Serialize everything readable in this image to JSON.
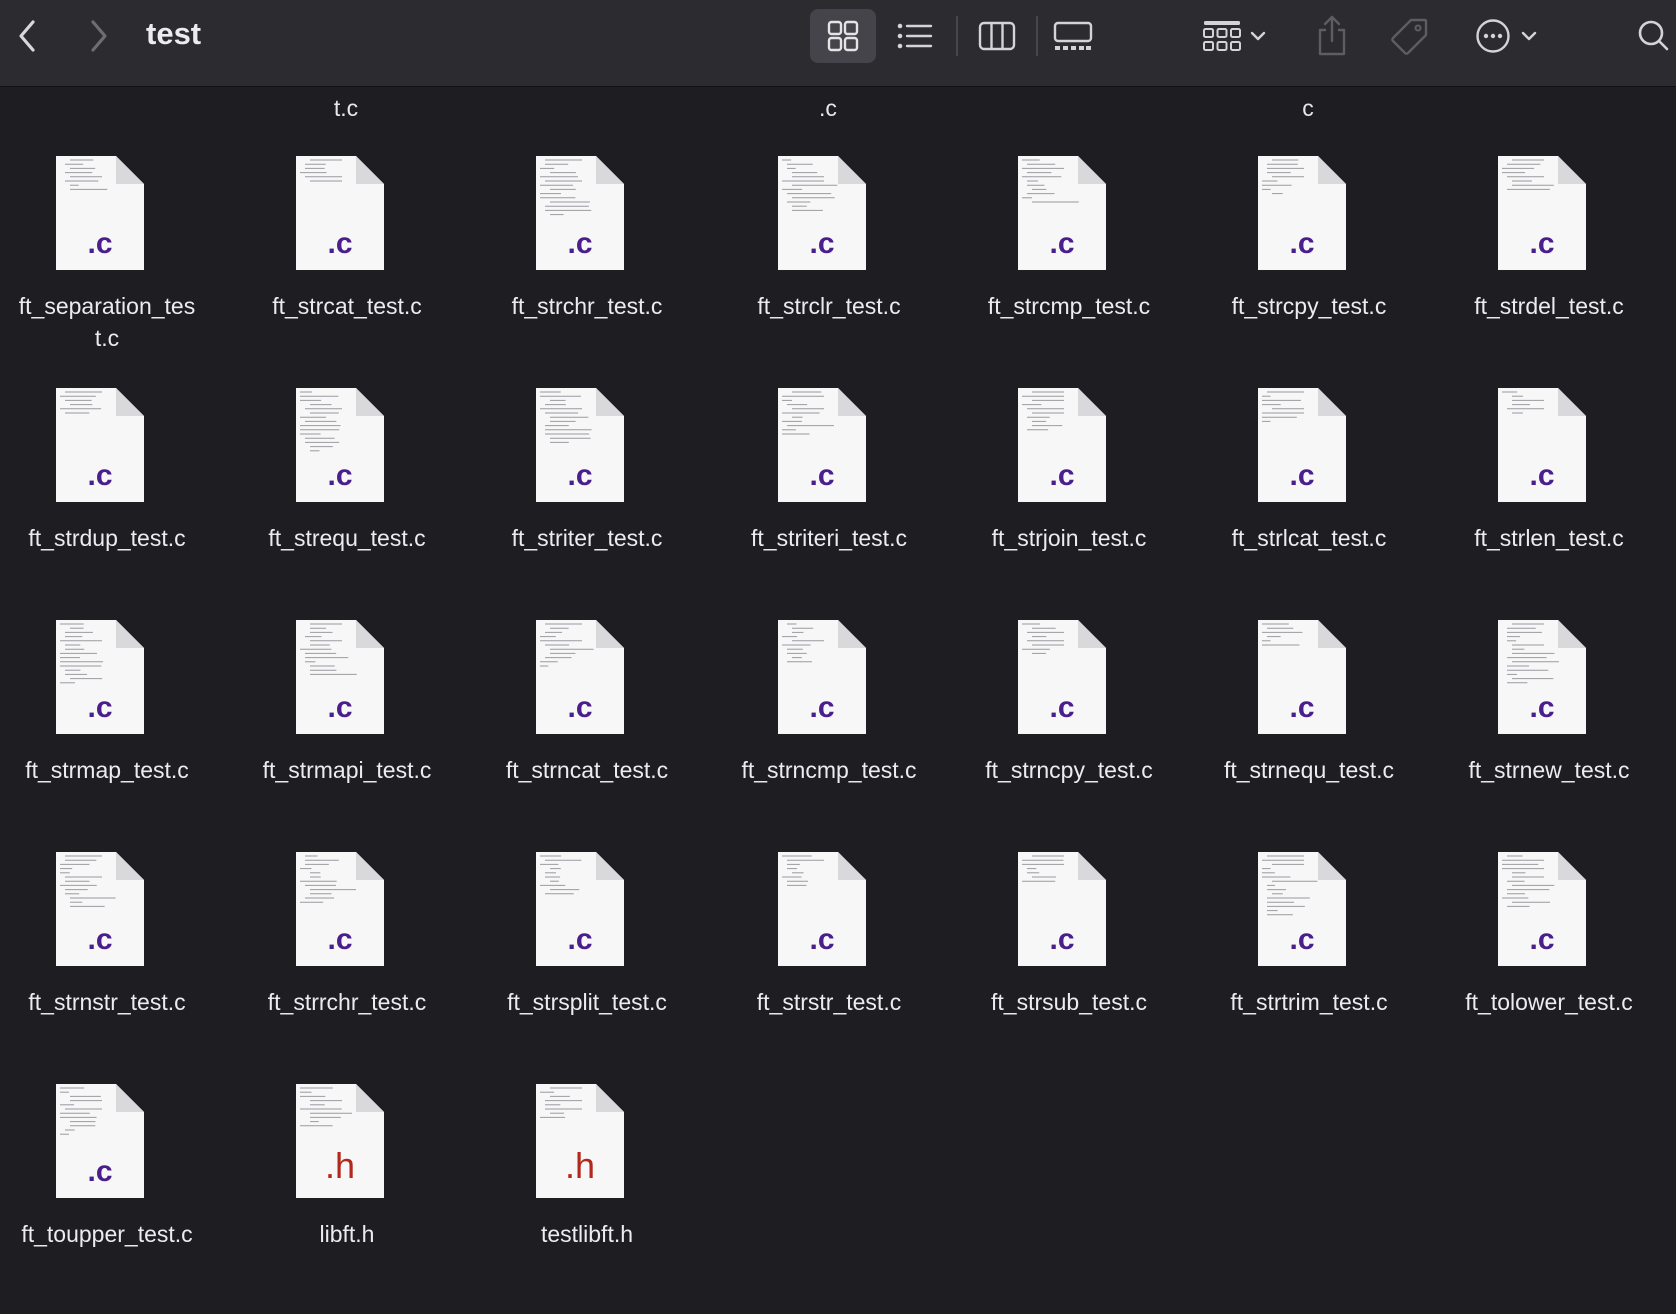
{
  "window": {
    "title": "test"
  },
  "toolbar": {
    "back_icon": "chevron-left-icon",
    "forward_icon": "chevron-right-icon",
    "views": [
      "icon-view-icon",
      "list-view-icon",
      "column-view-icon",
      "gallery-view-icon"
    ],
    "active_view": "icon-view-icon",
    "group_icon": "group-by-icon",
    "share_icon": "share-icon",
    "tag_icon": "tag-icon",
    "more_icon": "ellipsis-circle-icon",
    "search_icon": "search-icon"
  },
  "previous_row_labels": [
    "t.c",
    ".c",
    "c"
  ],
  "files": [
    {
      "name": "ft_separation_tes\nt.c",
      "ext": ".c"
    },
    {
      "name": "ft_strcat_test.c",
      "ext": ".c"
    },
    {
      "name": "ft_strchr_test.c",
      "ext": ".c"
    },
    {
      "name": "ft_strclr_test.c",
      "ext": ".c"
    },
    {
      "name": "ft_strcmp_test.c",
      "ext": ".c"
    },
    {
      "name": "ft_strcpy_test.c",
      "ext": ".c"
    },
    {
      "name": "ft_strdel_test.c",
      "ext": ".c"
    },
    {
      "name": "ft_strdup_test.c",
      "ext": ".c"
    },
    {
      "name": "ft_strequ_test.c",
      "ext": ".c"
    },
    {
      "name": "ft_striter_test.c",
      "ext": ".c"
    },
    {
      "name": "ft_striteri_test.c",
      "ext": ".c"
    },
    {
      "name": "ft_strjoin_test.c",
      "ext": ".c"
    },
    {
      "name": "ft_strlcat_test.c",
      "ext": ".c"
    },
    {
      "name": "ft_strlen_test.c",
      "ext": ".c"
    },
    {
      "name": "ft_strmap_test.c",
      "ext": ".c"
    },
    {
      "name": "ft_strmapi_test.c",
      "ext": ".c"
    },
    {
      "name": "ft_strncat_test.c",
      "ext": ".c"
    },
    {
      "name": "ft_strncmp_test.c",
      "ext": ".c"
    },
    {
      "name": "ft_strncpy_test.c",
      "ext": ".c"
    },
    {
      "name": "ft_strnequ_test.c",
      "ext": ".c"
    },
    {
      "name": "ft_strnew_test.c",
      "ext": ".c"
    },
    {
      "name": "ft_strnstr_test.c",
      "ext": ".c"
    },
    {
      "name": "ft_strrchr_test.c",
      "ext": ".c"
    },
    {
      "name": "ft_strsplit_test.c",
      "ext": ".c"
    },
    {
      "name": "ft_strstr_test.c",
      "ext": ".c"
    },
    {
      "name": "ft_strsub_test.c",
      "ext": ".c"
    },
    {
      "name": "ft_strtrim_test.c",
      "ext": ".c"
    },
    {
      "name": "ft_tolower_test.c",
      "ext": ".c"
    },
    {
      "name": "ft_toupper_test.c",
      "ext": ".c"
    },
    {
      "name": "libft.h",
      "ext": ".h"
    },
    {
      "name": "testlibft.h",
      "ext": ".h"
    }
  ]
}
